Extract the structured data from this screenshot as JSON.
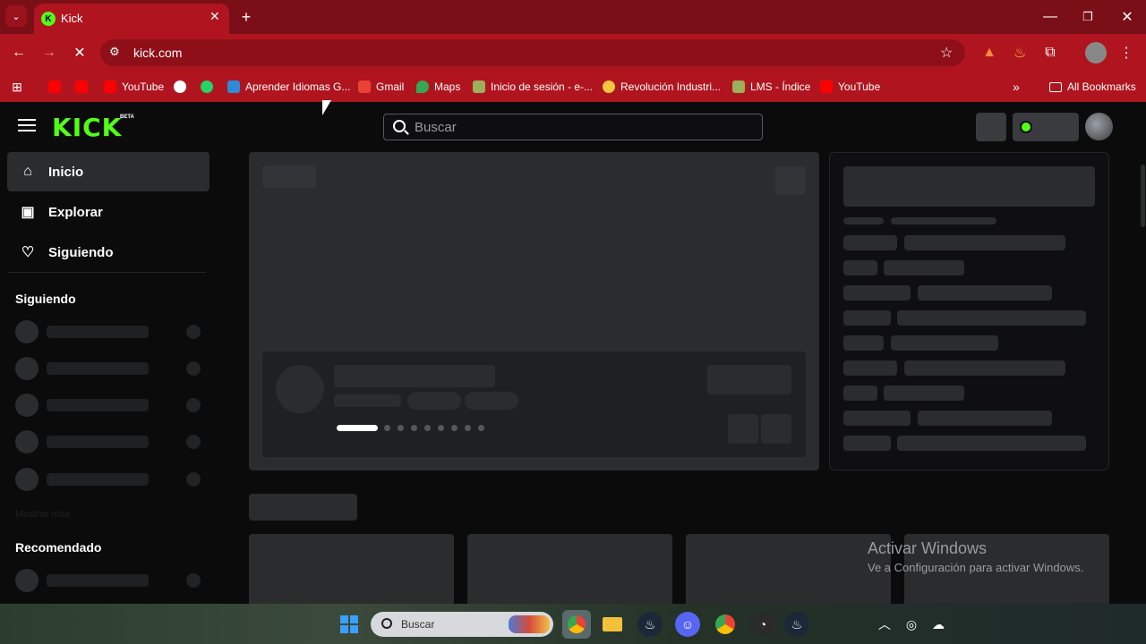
{
  "browser": {
    "tab_title": "Kick",
    "url": "kick.com",
    "bookmarks": [
      {
        "label": "YouTube"
      },
      {
        "label": "Aprender Idiomas G..."
      },
      {
        "label": "Gmail"
      },
      {
        "label": "Maps"
      },
      {
        "label": "Inicio de sesión - e-..."
      },
      {
        "label": "Revolución Industri..."
      },
      {
        "label": "LMS - Índice"
      },
      {
        "label": "YouTube"
      }
    ],
    "all_bookmarks": "All Bookmarks"
  },
  "site": {
    "logo": "KICK",
    "logo_badge": "BETA",
    "search_placeholder": "Buscar"
  },
  "sidebar": {
    "nav": [
      {
        "label": "Inicio",
        "icon": "home-icon"
      },
      {
        "label": "Explorar",
        "icon": "browse-icon"
      },
      {
        "label": "Siguiendo",
        "icon": "heart-icon"
      }
    ],
    "following_title": "Siguiendo",
    "show_more": "Mostrar más",
    "recommended_title": "Recomendado"
  },
  "watermark": {
    "title": "Activar Windows",
    "subtitle": "Ve a Configuración para activar Windows."
  },
  "taskbar": {
    "search_placeholder": "Buscar"
  },
  "colors": {
    "chrome_red": "#b0151f",
    "kick_green": "#53fc18",
    "skeleton": "#2b2c2e"
  }
}
